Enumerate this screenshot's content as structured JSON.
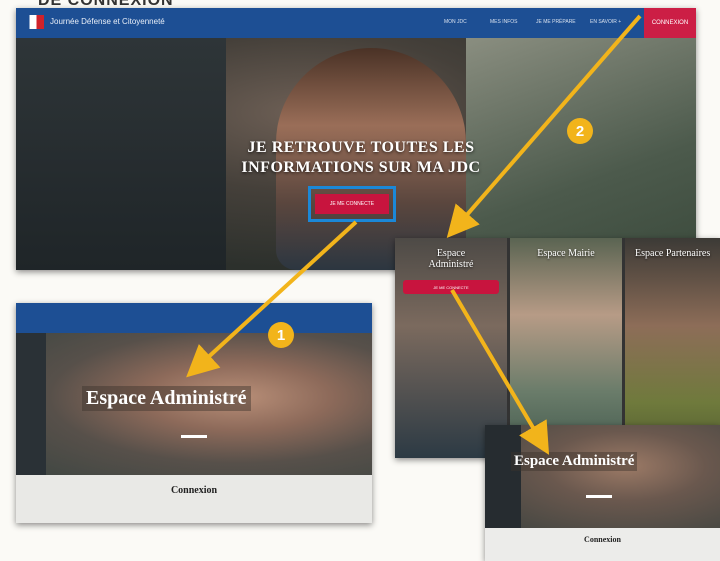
{
  "section_heading": "DE CONNEXION",
  "main_page": {
    "site_name": "Journée Défense et Citoyenneté",
    "nav_items": [
      "MON JDC",
      "MES INFOS",
      "JE ME PRÉPARE",
      "EN SAVOIR +"
    ],
    "nav_cta": "CONNEXION",
    "hero_line1": "JE RETROUVE TOUTES LES",
    "hero_line2": "INFORMATIONS SUR MA JDC",
    "hero_button": "JE ME CONNECTE"
  },
  "spaces_panel": {
    "spaces": [
      {
        "label_line1": "Espace",
        "label_line2": "Administré",
        "button": "JE ME CONNECTE"
      },
      {
        "label_line1": "Espace Mairie",
        "label_line2": ""
      },
      {
        "label_line1": "Espace Partenaires",
        "label_line2": ""
      }
    ]
  },
  "zoom_one": {
    "title": "Espace Administré",
    "connexion": "Connexion"
  },
  "zoom_two": {
    "title": "Espace Administré",
    "connexion": "Connexion"
  },
  "badges": [
    "1",
    "2"
  ],
  "colors": {
    "brand_blue": "#1d4f94",
    "cta_red": "#c8143e",
    "highlight_blue": "#1b88d8",
    "arrow_yellow": "#f2b41b"
  }
}
